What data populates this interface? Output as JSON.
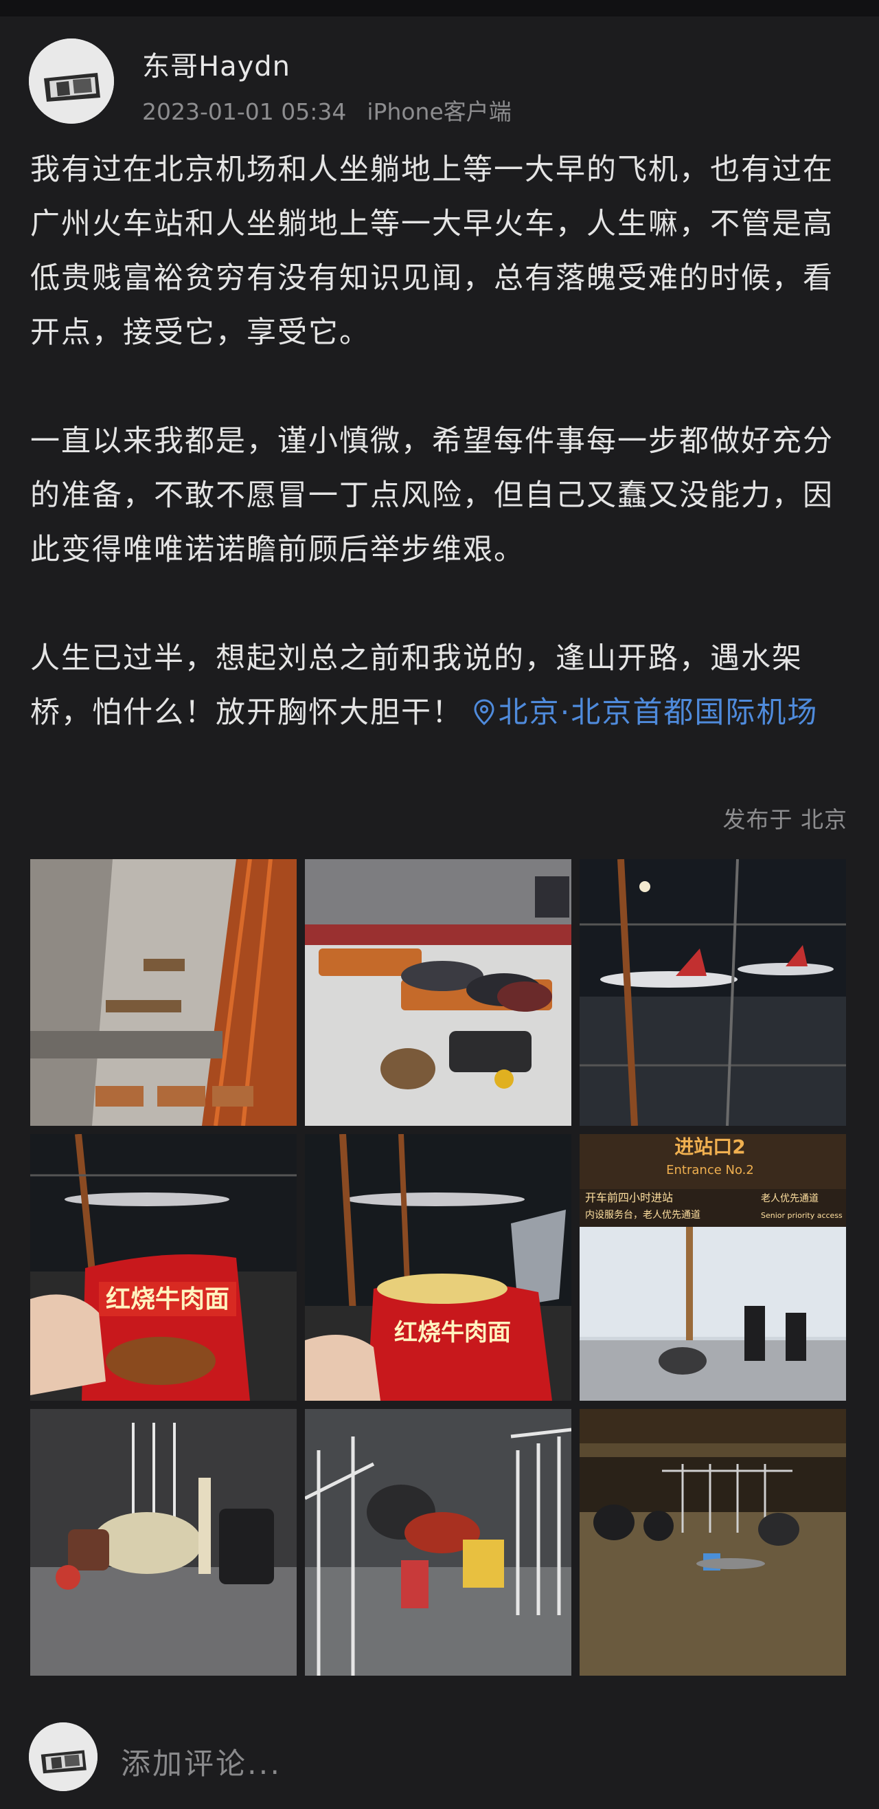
{
  "post": {
    "username": "东哥Haydn",
    "timestamp": "2023-01-01 05:34",
    "client": "iPhone客户端",
    "paragraphs": [
      "我有过在北京机场和人坐躺地上等一大早的飞机，也有过在广州火车站和人坐躺地上等一大早火车，人生嘛，不管是高低贵贱富裕贫穷有没有知识见闻，总有落魄受难的时候，看开点，接受它，享受它。",
      "一直以来我都是，谨小慎微，希望每件事每一步都做好充分的准备，不敢不愿冒一丁点风险，但自己又蠢又没能力，因此变得唯唯诺诺瞻前顾后举步维艰。",
      "人生已过半，想起刘总之前和我说的，逢山开路，遇水架桥，怕什么！放开胸怀大胆干！"
    ],
    "location": "北京·北京首都国际机场",
    "published_from": "发布于 北京"
  },
  "photos": {
    "noodle_label": "红烧牛肉面",
    "entrance_sign": "进站口2",
    "entrance_sign_en": "Entrance No.2",
    "entrance_notice": "开车前四小时进站",
    "entrance_service": "内设服务台，老人优先通道",
    "senior_lane": "老人优先通道",
    "senior_lane_en": "Senior priority access"
  },
  "comment": {
    "placeholder": "添加评论..."
  },
  "colors": {
    "background": "#1c1c1e",
    "text": "#e4e4e4",
    "meta": "#8d8d8f",
    "link": "#4f8bdc"
  }
}
